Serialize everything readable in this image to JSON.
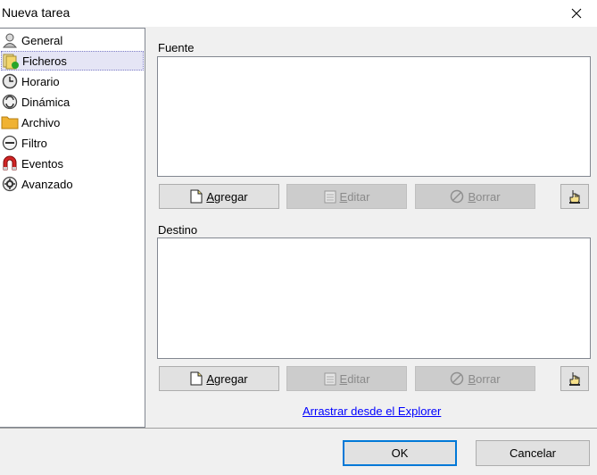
{
  "window": {
    "title": "Nueva tarea"
  },
  "sidebar": {
    "items": [
      {
        "label": "General",
        "icon": "user-icon"
      },
      {
        "label": "Ficheros",
        "icon": "files-icon",
        "selected": true
      },
      {
        "label": "Horario",
        "icon": "clock-icon"
      },
      {
        "label": "Dinámica",
        "icon": "dynamic-icon"
      },
      {
        "label": "Archivo",
        "icon": "folder-icon"
      },
      {
        "label": "Filtro",
        "icon": "filter-icon"
      },
      {
        "label": "Eventos",
        "icon": "magnet-icon"
      },
      {
        "label": "Avanzado",
        "icon": "gear-icon"
      }
    ]
  },
  "source": {
    "label": "Fuente",
    "add": {
      "u": "A",
      "rest": "gregar"
    },
    "edit": {
      "u": "E",
      "rest": "ditar"
    },
    "delete": {
      "u": "B",
      "rest": "orrar"
    }
  },
  "destination": {
    "label": "Destino",
    "add": {
      "u": "A",
      "rest": "gregar"
    },
    "edit": {
      "u": "E",
      "rest": "ditar"
    },
    "delete": {
      "u": "B",
      "rest": "orrar"
    }
  },
  "drag_link": "Arrastrar desde el Explorer",
  "footer": {
    "ok": {
      "u": "O",
      "rest": "K"
    },
    "cancel": {
      "u": "C",
      "rest": "ancelar"
    }
  }
}
